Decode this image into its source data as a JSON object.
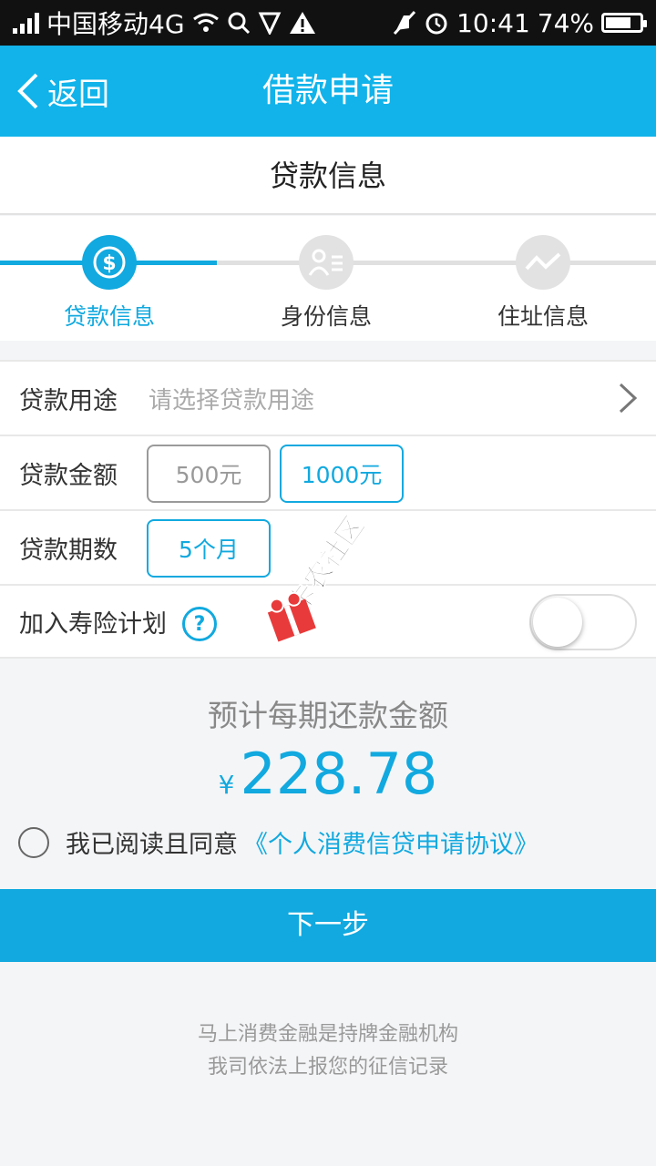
{
  "status_bar": {
    "carrier": "中国移动4G",
    "time": "10:41",
    "battery": "74%",
    "battery_level": 0.74
  },
  "nav": {
    "back_label": "返回",
    "title": "借款申请"
  },
  "section_title": "贷款信息",
  "steps": [
    {
      "label": "贷款信息",
      "icon": "dollar-icon",
      "active": true
    },
    {
      "label": "身份信息",
      "icon": "id-card-icon",
      "active": false
    },
    {
      "label": "住址信息",
      "icon": "location-wave-icon",
      "active": false
    }
  ],
  "form": {
    "purpose_label": "贷款用途",
    "purpose_placeholder": "请选择贷款用途",
    "amount_label": "贷款金额",
    "amount_options": [
      "500元",
      "1000元"
    ],
    "amount_selected": "1000元",
    "term_label": "贷款期数",
    "term_options": [
      "5个月"
    ],
    "term_selected": "5个月",
    "insurance_label": "加入寿险计划",
    "insurance_help": "?",
    "insurance_enabled": false
  },
  "summary": {
    "estimate_label": "预计每期还款金额",
    "currency": "¥",
    "amount": "228.78",
    "agree_text": "我已阅读且同意",
    "agreement_link": "《个人消费信贷申请协议》"
  },
  "next_button": "下一步",
  "footer": {
    "line1": "马上消费金融是持牌金融机构",
    "line2": "我司依法上报您的征信记录"
  },
  "watermark": "卡农社区",
  "colors": {
    "primary": "#11a9df",
    "nav": "#11b3ea"
  }
}
